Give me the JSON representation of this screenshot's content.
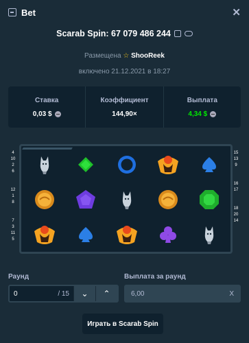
{
  "header": {
    "title": "Bet",
    "close": "✕"
  },
  "bet": {
    "title": "Scarab Spin: 67 079 486 244",
    "placed_prefix": "Размещена",
    "user": "ShooReek",
    "date": "включено 21.12.2021 в 18:27"
  },
  "stats": [
    {
      "label": "Ставка",
      "value": "0,03 $"
    },
    {
      "label": "Коэффициент",
      "value": "144,90×"
    },
    {
      "label": "Выплата",
      "value": "4,34 $"
    }
  ],
  "paylines": {
    "left": [
      [
        "4",
        "10",
        "2",
        "6"
      ],
      [
        "12",
        "1",
        "8"
      ],
      [
        "7",
        "3",
        "11",
        "5"
      ]
    ],
    "right": [
      [
        "15",
        "13",
        "9"
      ],
      [
        "16",
        "17"
      ],
      [
        "18",
        "20",
        "14"
      ]
    ]
  },
  "grid": [
    [
      "wolf",
      "diamond-green",
      "ring-blue",
      "scarab",
      "spade-blue"
    ],
    [
      "coin",
      "pentagon-purple",
      "wolf",
      "coin",
      "emerald-green"
    ],
    [
      "scarab",
      "spade-blue",
      "scarab",
      "club-purple",
      "wolf"
    ]
  ],
  "form": {
    "round_label": "Раунд",
    "payout_label": "Выплата за раунд",
    "round_value": "0",
    "round_max": "/ 15",
    "payout_value": "6,00",
    "payout_clear": "X"
  },
  "play_label": "Играть в Scarab Spin",
  "colors": {
    "accent": "#00e701",
    "bg": "#1a2c38",
    "panel": "#0f212e"
  }
}
